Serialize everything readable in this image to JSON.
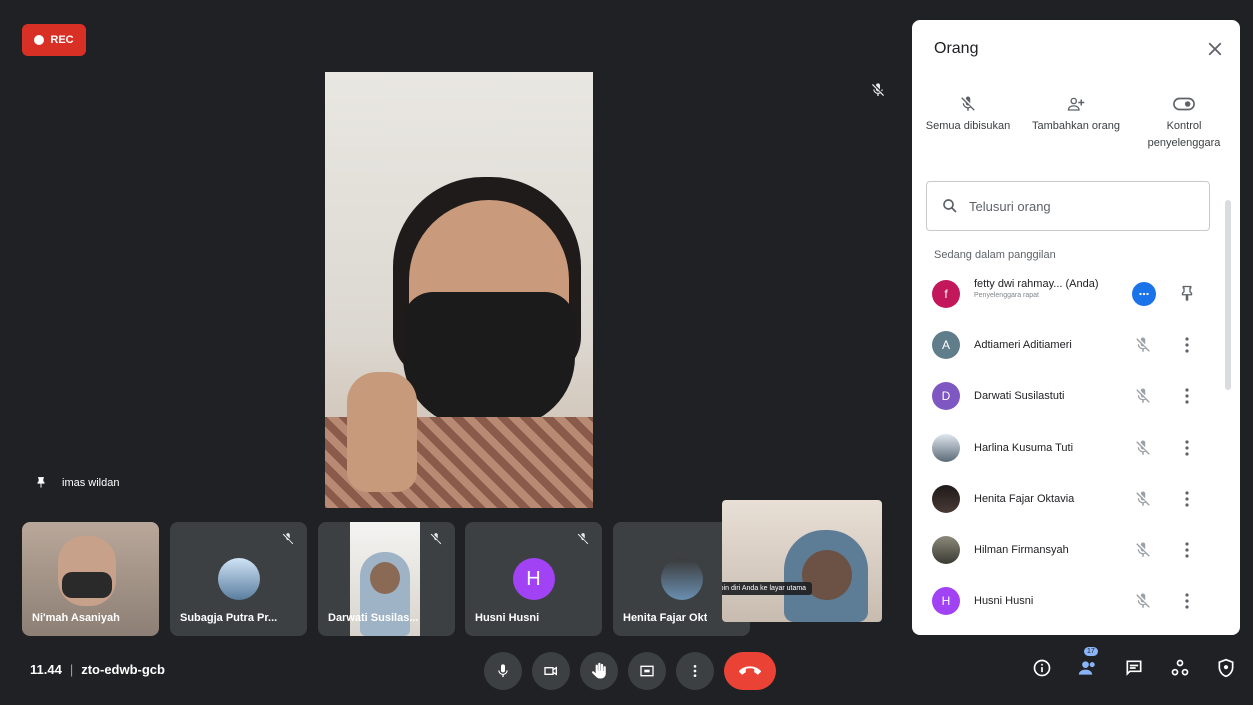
{
  "recording": {
    "label": "REC"
  },
  "presenter": {
    "name": "imas wildan"
  },
  "tiles": [
    {
      "name": "Ni'mah Asaniyah",
      "type": "video"
    },
    {
      "name": "Subagja Putra Pr...",
      "type": "avatar-photo"
    },
    {
      "name": "Darwati Susilas...",
      "type": "video"
    },
    {
      "name": "Husni Husni",
      "type": "letter",
      "letter": "H",
      "color": "#a142f4"
    },
    {
      "name": "Henita Fajar Okt",
      "type": "avatar-photo"
    }
  ],
  "selfview": {
    "tooltip": "Pasang pin diri Anda ke layar utama"
  },
  "meeting": {
    "time": "11.44",
    "separator": "|",
    "code": "zto-edwb-gcb"
  },
  "participants_badge": "17",
  "panel": {
    "title": "Orang",
    "actions": [
      {
        "label": "Semua dibisukan",
        "icon": "mic-off-icon"
      },
      {
        "label": "Tambahkan orang",
        "icon": "person-add-icon"
      },
      {
        "label": "Kontrol penyelenggara",
        "icon": "toggle-icon"
      }
    ],
    "search_placeholder": "Telusuri orang",
    "section_label": "Sedang dalam panggilan",
    "people": [
      {
        "name": "fetty dwi rahmay... (Anda)",
        "role": "Penyelenggara rapat",
        "letter": "f",
        "color": "#c2185b",
        "host": true
      },
      {
        "name": "Adtiameri Aditiameri",
        "letter": "A",
        "color": "#607d8b"
      },
      {
        "name": "Darwati Susilastuti",
        "letter": "D",
        "color": "#7e57c2"
      },
      {
        "name": "Harlina Kusuma Tuti",
        "letter": "",
        "color": "#9aa0a6"
      },
      {
        "name": "Henita Fajar Oktavia",
        "letter": "",
        "color": "#2f2a28"
      },
      {
        "name": "Hilman Firmansyah",
        "letter": "",
        "color": "#6d6b5e"
      },
      {
        "name": "Husni Husni",
        "letter": "H",
        "color": "#a142f4"
      }
    ]
  }
}
